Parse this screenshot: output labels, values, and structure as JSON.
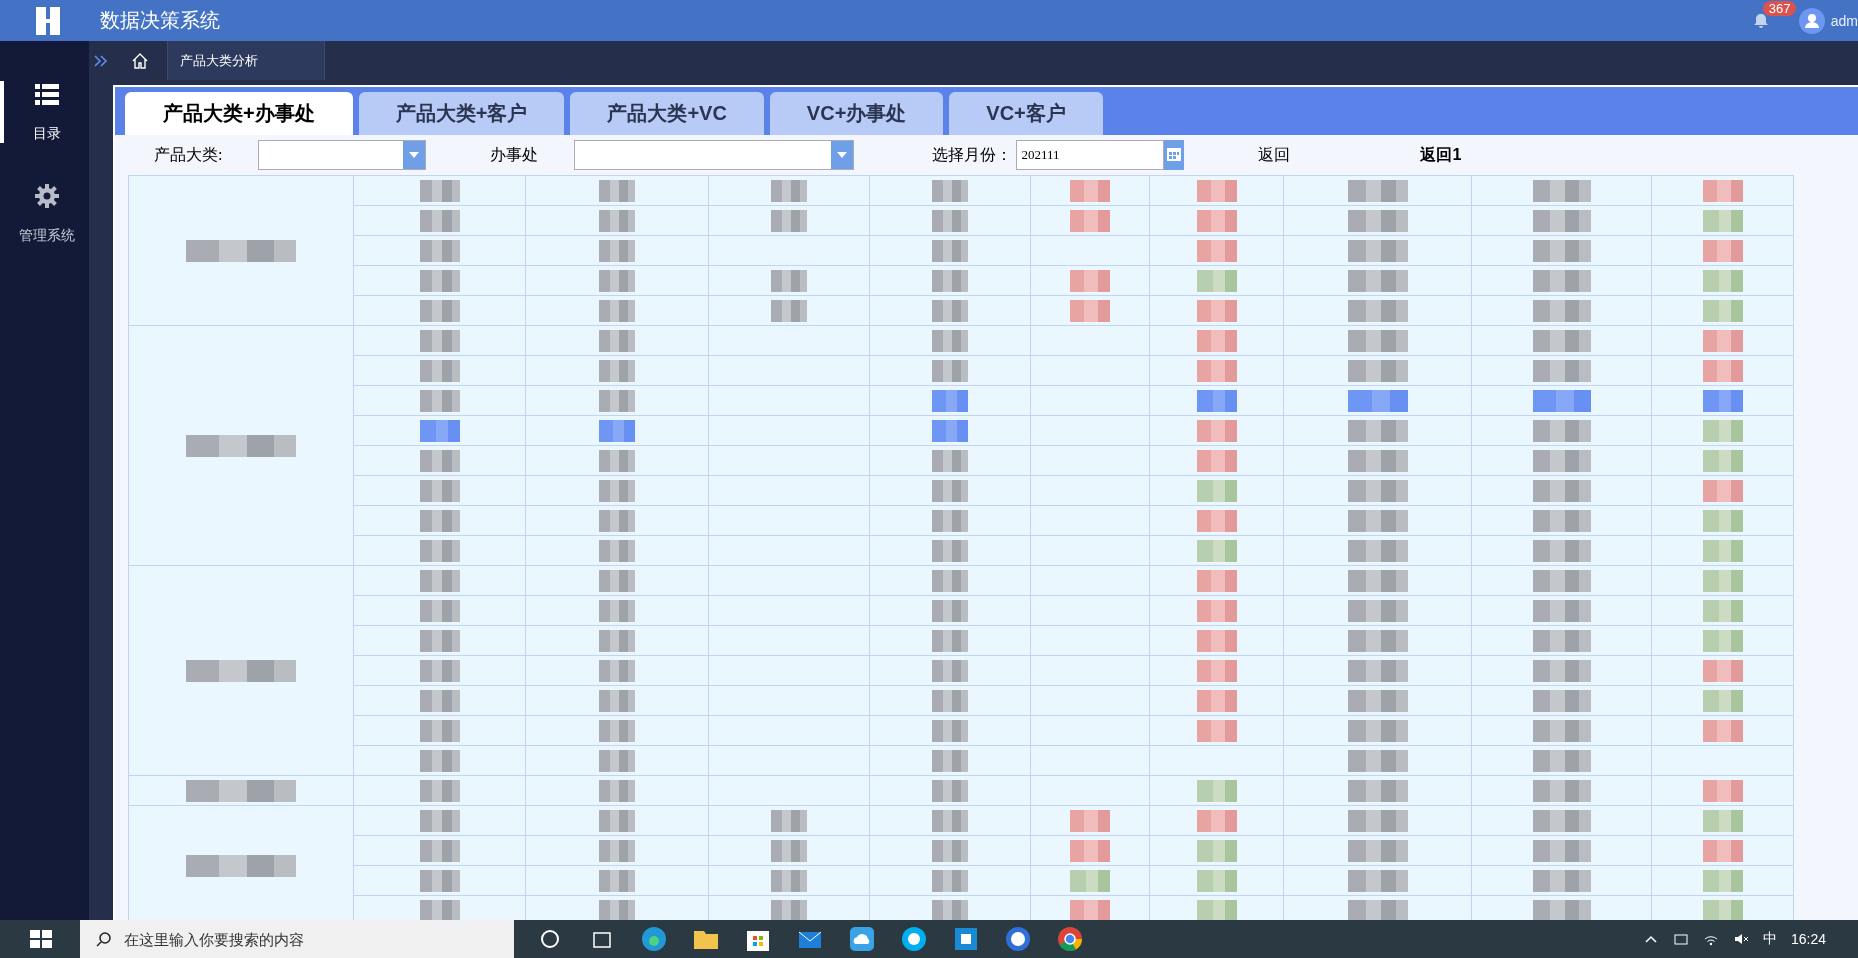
{
  "header": {
    "title": "数据决策系统",
    "notification_count": "367",
    "user": "adm"
  },
  "sidebar": {
    "items": [
      {
        "label": "目录",
        "kind": "list",
        "selected": true
      },
      {
        "label": "管理系统",
        "kind": "gear",
        "selected": false
      }
    ]
  },
  "breadcrumb": {
    "tab": "产品大类分析"
  },
  "tabs": [
    {
      "label": "产品大类+办事处",
      "selected": true
    },
    {
      "label": "产品大类+客户",
      "selected": false
    },
    {
      "label": "产品大类+VC",
      "selected": false
    },
    {
      "label": "VC+办事处",
      "selected": false
    },
    {
      "label": "VC+客户",
      "selected": false
    }
  ],
  "filters": {
    "category_label": "产品大类:",
    "office_label": "办事处",
    "month_label": "选择月份：",
    "month_value": "202111",
    "links": [
      "返回",
      "返回1"
    ]
  },
  "table": {
    "groups": [
      {
        "label": {
          "kind": "gray"
        },
        "rows": [
          {
            "cells": [
              {
                "kind": "gray"
              },
              {
                "kind": "gray"
              },
              {
                "kind": "gray"
              },
              {
                "kind": "gray"
              },
              {
                "kind": "red"
              },
              {
                "kind": "red"
              },
              {
                "kind": "gray"
              },
              {
                "kind": "gray"
              },
              {
                "kind": "red"
              }
            ]
          },
          {
            "cells": [
              {
                "kind": "gray"
              },
              {
                "kind": "gray"
              },
              {
                "kind": "gray"
              },
              {
                "kind": "gray"
              },
              {
                "kind": "red"
              },
              {
                "kind": "red"
              },
              {
                "kind": "gray"
              },
              {
                "kind": "gray"
              },
              {
                "kind": "green"
              }
            ]
          },
          {
            "cells": [
              {
                "kind": "gray"
              },
              {
                "kind": "gray"
              },
              {
                "kind": "blank"
              },
              {
                "kind": "gray"
              },
              {
                "kind": "blank"
              },
              {
                "kind": "red"
              },
              {
                "kind": "gray"
              },
              {
                "kind": "gray"
              },
              {
                "kind": "red"
              }
            ]
          },
          {
            "cells": [
              {
                "kind": "gray"
              },
              {
                "kind": "gray"
              },
              {
                "kind": "gray"
              },
              {
                "kind": "gray"
              },
              {
                "kind": "red"
              },
              {
                "kind": "green"
              },
              {
                "kind": "gray"
              },
              {
                "kind": "gray"
              },
              {
                "kind": "green"
              }
            ]
          },
          {
            "cells": [
              {
                "kind": "gray"
              },
              {
                "kind": "gray"
              },
              {
                "kind": "gray"
              },
              {
                "kind": "gray"
              },
              {
                "kind": "red"
              },
              {
                "kind": "red"
              },
              {
                "kind": "gray"
              },
              {
                "kind": "gray"
              },
              {
                "kind": "green"
              }
            ]
          }
        ]
      },
      {
        "label": {
          "kind": "gray"
        },
        "rows": [
          {
            "cells": [
              {
                "kind": "gray"
              },
              {
                "kind": "gray"
              },
              {
                "kind": "blank"
              },
              {
                "kind": "gray"
              },
              {
                "kind": "blank"
              },
              {
                "kind": "red"
              },
              {
                "kind": "gray"
              },
              {
                "kind": "gray"
              },
              {
                "kind": "red"
              }
            ]
          },
          {
            "cells": [
              {
                "kind": "gray"
              },
              {
                "kind": "gray"
              },
              {
                "kind": "blank"
              },
              {
                "kind": "gray"
              },
              {
                "kind": "blank"
              },
              {
                "kind": "red"
              },
              {
                "kind": "gray"
              },
              {
                "kind": "gray"
              },
              {
                "kind": "red"
              }
            ]
          },
          {
            "cells": [
              {
                "kind": "gray"
              },
              {
                "kind": "gray"
              },
              {
                "kind": "blank"
              },
              {
                "kind": "blue"
              },
              {
                "kind": "blank"
              },
              {
                "kind": "blue"
              },
              {
                "kind": "blue"
              },
              {
                "kind": "blue"
              },
              {
                "kind": "blue"
              }
            ]
          },
          {
            "cells": [
              {
                "kind": "blue"
              },
              {
                "kind": "blue"
              },
              {
                "kind": "blank"
              },
              {
                "kind": "blue"
              },
              {
                "kind": "blank"
              },
              {
                "kind": "red"
              },
              {
                "kind": "gray"
              },
              {
                "kind": "gray"
              },
              {
                "kind": "green"
              }
            ]
          },
          {
            "cells": [
              {
                "kind": "gray"
              },
              {
                "kind": "gray"
              },
              {
                "kind": "blank"
              },
              {
                "kind": "gray"
              },
              {
                "kind": "blank"
              },
              {
                "kind": "red"
              },
              {
                "kind": "gray"
              },
              {
                "kind": "gray"
              },
              {
                "kind": "green"
              }
            ]
          },
          {
            "cells": [
              {
                "kind": "gray"
              },
              {
                "kind": "gray"
              },
              {
                "kind": "blank"
              },
              {
                "kind": "gray"
              },
              {
                "kind": "blank"
              },
              {
                "kind": "green"
              },
              {
                "kind": "gray"
              },
              {
                "kind": "gray"
              },
              {
                "kind": "red"
              }
            ]
          },
          {
            "cells": [
              {
                "kind": "gray"
              },
              {
                "kind": "gray"
              },
              {
                "kind": "blank"
              },
              {
                "kind": "gray"
              },
              {
                "kind": "blank"
              },
              {
                "kind": "red"
              },
              {
                "kind": "gray"
              },
              {
                "kind": "gray"
              },
              {
                "kind": "green"
              }
            ]
          },
          {
            "cells": [
              {
                "kind": "gray"
              },
              {
                "kind": "gray"
              },
              {
                "kind": "blank"
              },
              {
                "kind": "gray"
              },
              {
                "kind": "blank"
              },
              {
                "kind": "green"
              },
              {
                "kind": "gray"
              },
              {
                "kind": "gray"
              },
              {
                "kind": "green"
              }
            ]
          }
        ]
      },
      {
        "label": {
          "kind": "gray"
        },
        "rows": [
          {
            "cells": [
              {
                "kind": "gray"
              },
              {
                "kind": "gray"
              },
              {
                "kind": "blank"
              },
              {
                "kind": "gray"
              },
              {
                "kind": "blank"
              },
              {
                "kind": "red"
              },
              {
                "kind": "gray"
              },
              {
                "kind": "gray"
              },
              {
                "kind": "green"
              }
            ]
          },
          {
            "cells": [
              {
                "kind": "gray"
              },
              {
                "kind": "gray"
              },
              {
                "kind": "blank"
              },
              {
                "kind": "gray"
              },
              {
                "kind": "blank"
              },
              {
                "kind": "red"
              },
              {
                "kind": "gray"
              },
              {
                "kind": "gray"
              },
              {
                "kind": "green"
              }
            ]
          },
          {
            "cells": [
              {
                "kind": "gray"
              },
              {
                "kind": "gray"
              },
              {
                "kind": "blank"
              },
              {
                "kind": "gray"
              },
              {
                "kind": "blank"
              },
              {
                "kind": "red"
              },
              {
                "kind": "gray"
              },
              {
                "kind": "gray"
              },
              {
                "kind": "green"
              }
            ]
          },
          {
            "cells": [
              {
                "kind": "gray"
              },
              {
                "kind": "gray"
              },
              {
                "kind": "blank"
              },
              {
                "kind": "gray"
              },
              {
                "kind": "blank"
              },
              {
                "kind": "red"
              },
              {
                "kind": "gray"
              },
              {
                "kind": "gray"
              },
              {
                "kind": "red"
              }
            ]
          },
          {
            "cells": [
              {
                "kind": "gray"
              },
              {
                "kind": "gray"
              },
              {
                "kind": "blank"
              },
              {
                "kind": "gray"
              },
              {
                "kind": "blank"
              },
              {
                "kind": "red"
              },
              {
                "kind": "gray"
              },
              {
                "kind": "gray"
              },
              {
                "kind": "green"
              }
            ]
          },
          {
            "cells": [
              {
                "kind": "gray"
              },
              {
                "kind": "gray"
              },
              {
                "kind": "blank"
              },
              {
                "kind": "gray"
              },
              {
                "kind": "blank"
              },
              {
                "kind": "red"
              },
              {
                "kind": "gray"
              },
              {
                "kind": "gray"
              },
              {
                "kind": "red"
              }
            ]
          },
          {
            "cells": [
              {
                "kind": "gray"
              },
              {
                "kind": "gray"
              },
              {
                "kind": "blank"
              },
              {
                "kind": "gray"
              },
              {
                "kind": "blank"
              },
              {
                "kind": "blank"
              },
              {
                "kind": "gray"
              },
              {
                "kind": "gray"
              },
              {
                "kind": "blank"
              }
            ]
          }
        ]
      },
      {
        "label": {
          "kind": "gray"
        },
        "rows": [
          {
            "cells": [
              {
                "kind": "gray"
              },
              {
                "kind": "gray"
              },
              {
                "kind": "blank"
              },
              {
                "kind": "gray"
              },
              {
                "kind": "blank"
              },
              {
                "kind": "green"
              },
              {
                "kind": "gray"
              },
              {
                "kind": "gray"
              },
              {
                "kind": "red"
              }
            ]
          }
        ]
      },
      {
        "label": {
          "kind": "gray"
        },
        "rows": [
          {
            "cells": [
              {
                "kind": "gray"
              },
              {
                "kind": "gray"
              },
              {
                "kind": "gray"
              },
              {
                "kind": "gray"
              },
              {
                "kind": "red"
              },
              {
                "kind": "red"
              },
              {
                "kind": "gray"
              },
              {
                "kind": "gray"
              },
              {
                "kind": "green"
              }
            ]
          },
          {
            "cells": [
              {
                "kind": "gray"
              },
              {
                "kind": "gray"
              },
              {
                "kind": "gray"
              },
              {
                "kind": "gray"
              },
              {
                "kind": "red"
              },
              {
                "kind": "green"
              },
              {
                "kind": "gray"
              },
              {
                "kind": "gray"
              },
              {
                "kind": "red"
              }
            ]
          },
          {
            "cells": [
              {
                "kind": "gray"
              },
              {
                "kind": "gray"
              },
              {
                "kind": "gray"
              },
              {
                "kind": "gray"
              },
              {
                "kind": "green"
              },
              {
                "kind": "green"
              },
              {
                "kind": "gray"
              },
              {
                "kind": "gray"
              },
              {
                "kind": "green"
              }
            ]
          },
          {
            "cells": [
              {
                "kind": "gray"
              },
              {
                "kind": "gray"
              },
              {
                "kind": "gray"
              },
              {
                "kind": "gray"
              },
              {
                "kind": "red"
              },
              {
                "kind": "green"
              },
              {
                "kind": "gray"
              },
              {
                "kind": "gray"
              },
              {
                "kind": "green"
              }
            ]
          }
        ]
      }
    ]
  },
  "taskbar": {
    "search_placeholder": "在这里输入你要搜索的内容",
    "ime": "中",
    "time": "16:24"
  }
}
